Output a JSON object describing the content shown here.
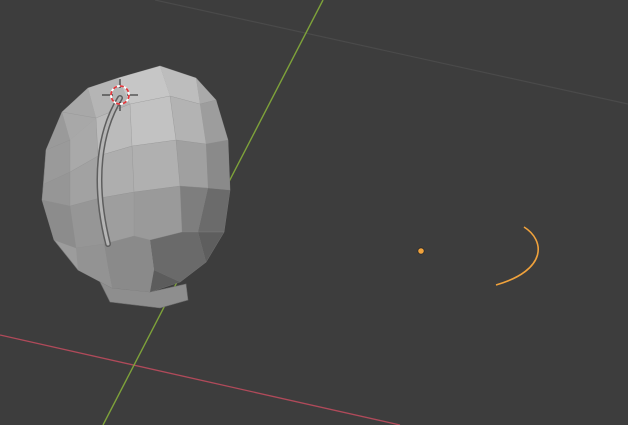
{
  "app": {
    "name": "3D Viewport"
  },
  "colors": {
    "background": "#3d3d3d",
    "grid_line": "#4a4a4a",
    "x_axis": "#b04a5a",
    "y_axis": "#7ea23a",
    "selection_origin": "#f0a23c",
    "mesh_light": "#b8b8b8",
    "mesh_mid": "#9a9a9a",
    "mesh_dark": "#6e6e6e",
    "mesh_shadow": "#5a5a5a",
    "cursor_red": "#e0363b",
    "cursor_white": "#ffffff"
  },
  "scene": {
    "objects": [
      {
        "name": "head-mesh",
        "type": "mesh"
      },
      {
        "name": "curve-strand",
        "type": "curve"
      },
      {
        "name": "light-origin",
        "type": "empty"
      }
    ],
    "icons": [
      "3d-cursor-icon",
      "object-origin-icon",
      "selection-arc-icon"
    ]
  }
}
